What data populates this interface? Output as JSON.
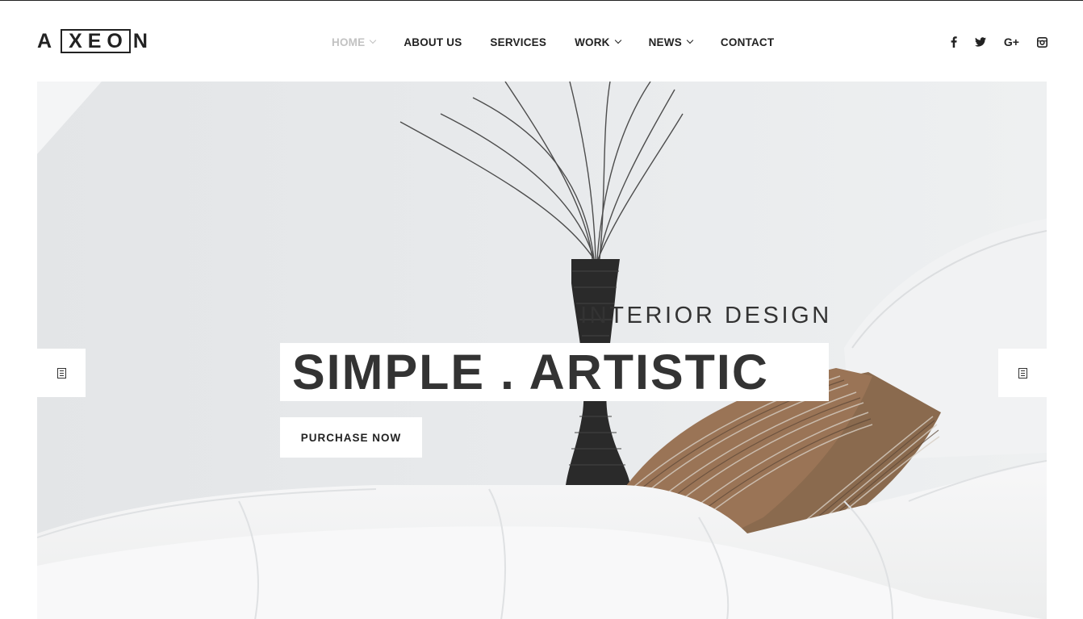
{
  "brand": {
    "logo_first": "A",
    "logo_boxed": "XEO",
    "logo_last": "N"
  },
  "nav": {
    "items": [
      {
        "label": "HOME",
        "has_dropdown": true,
        "active": true
      },
      {
        "label": "ABOUT US",
        "has_dropdown": false,
        "active": false
      },
      {
        "label": "SERVICES",
        "has_dropdown": false,
        "active": false
      },
      {
        "label": "WORK",
        "has_dropdown": true,
        "active": false
      },
      {
        "label": "NEWS",
        "has_dropdown": true,
        "active": false
      },
      {
        "label": "CONTACT",
        "has_dropdown": false,
        "active": false
      }
    ]
  },
  "social": {
    "icons": [
      "facebook-icon",
      "twitter-icon",
      "google-plus-icon",
      "instagram-icon"
    ],
    "google_plus_text": "G+"
  },
  "hero": {
    "eyebrow": "INTERIOR DESIGN",
    "headline": "SIMPLE . ARTISTIC",
    "cta_label": "PURCHASE NOW",
    "prev_icon": "slider-prev-icon",
    "next_icon": "slider-next-icon"
  },
  "colors": {
    "text": "#222222",
    "nav_active": "#c2c2c2",
    "hero_bg": "#e8eaec",
    "panel": "#ffffff"
  }
}
